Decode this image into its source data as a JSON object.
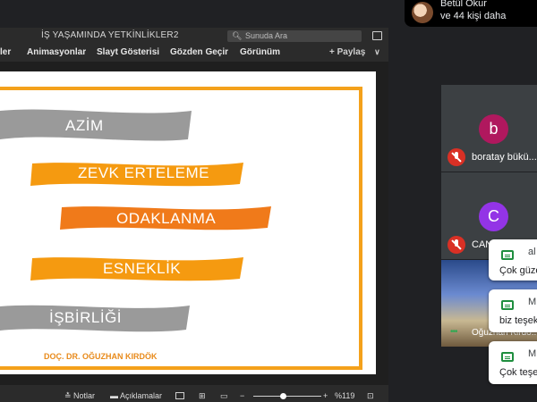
{
  "notice": {
    "line1": "Betül Okur",
    "line2": "ve 44 kişi daha"
  },
  "ppt": {
    "title": "İŞ YAŞAMINDA  YETKİNLİKLER2",
    "search_placeholder": "Sunuda Ara",
    "ribbon_tabs": [
      "ler",
      "Animasyonlar",
      "Slayt Gösterisi",
      "Gözden Geçir",
      "Görünüm"
    ],
    "share_label": "Paylaş",
    "status": {
      "notes": "Notlar",
      "comments": "Açıklamalar",
      "zoom": "%119",
      "zoom_level": 0.4
    }
  },
  "slide": {
    "items": [
      "AZİM",
      "ZEVK ERTELEME",
      "ODAKLANMA",
      "ESNEKLİK",
      "İŞBİRLİĞİ"
    ],
    "author": "DOÇ. DR. OĞUZHAN KIRDÖK",
    "colors": {
      "gray": "#9a9a9a",
      "orange": "#f59a10",
      "deep_orange": "#f07a1a",
      "frame": "#f4a11b"
    }
  },
  "participants": [
    {
      "initial": "b",
      "name": "boratay bükü...",
      "color": "#b0185e"
    },
    {
      "initial": "C",
      "name": "CANAN KAN...",
      "color": "#9334e6"
    },
    {
      "name": "Oğuzhan Kirdö..."
    }
  ],
  "toasts": [
    {
      "who": "al",
      "msg": "Çok güzel"
    },
    {
      "who": "M",
      "msg": "biz teşek"
    },
    {
      "who": "M",
      "msg": "Çok teşe"
    }
  ]
}
